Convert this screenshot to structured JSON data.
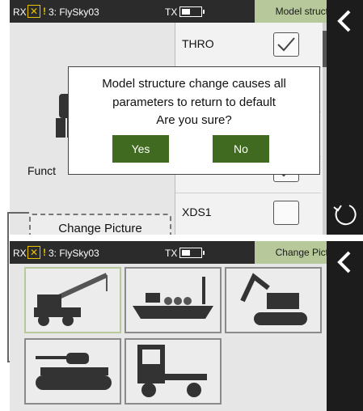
{
  "top_screen": {
    "statusbar": {
      "rx": "RX",
      "warn": "!",
      "model": "3: FlySky03",
      "tx": "TX",
      "page": "Model structure"
    },
    "left": {
      "func_label": "Funct",
      "change_picture": "Change Picture"
    },
    "list": [
      {
        "label": "THRO",
        "checked": true
      },
      {
        "label": "",
        "checked": false
      },
      {
        "label": "",
        "checked": false
      },
      {
        "label": "",
        "checked": true
      },
      {
        "label": "XDS1",
        "checked": false
      }
    ],
    "dialog": {
      "line1": "Model structure change causes all",
      "line2": "parameters to return to default",
      "line3": "Are you sure?",
      "yes": "Yes",
      "no": "No"
    }
  },
  "bottom_screen": {
    "statusbar": {
      "rx": "RX",
      "warn": "!",
      "model": "3: FlySky03",
      "tx": "TX",
      "page": "Change Picture"
    },
    "tiles": [
      {
        "icon": "crane-truck-icon",
        "selected": true
      },
      {
        "icon": "cargo-ship-icon",
        "selected": false
      },
      {
        "icon": "excavator-icon",
        "selected": false
      },
      {
        "icon": "tank-icon",
        "selected": false
      },
      {
        "icon": "semi-truck-icon",
        "selected": false
      }
    ]
  },
  "colors": {
    "accent": "#b7c99a",
    "dialog_button": "#3f6a1f",
    "status_yellow": "#e6c200"
  }
}
